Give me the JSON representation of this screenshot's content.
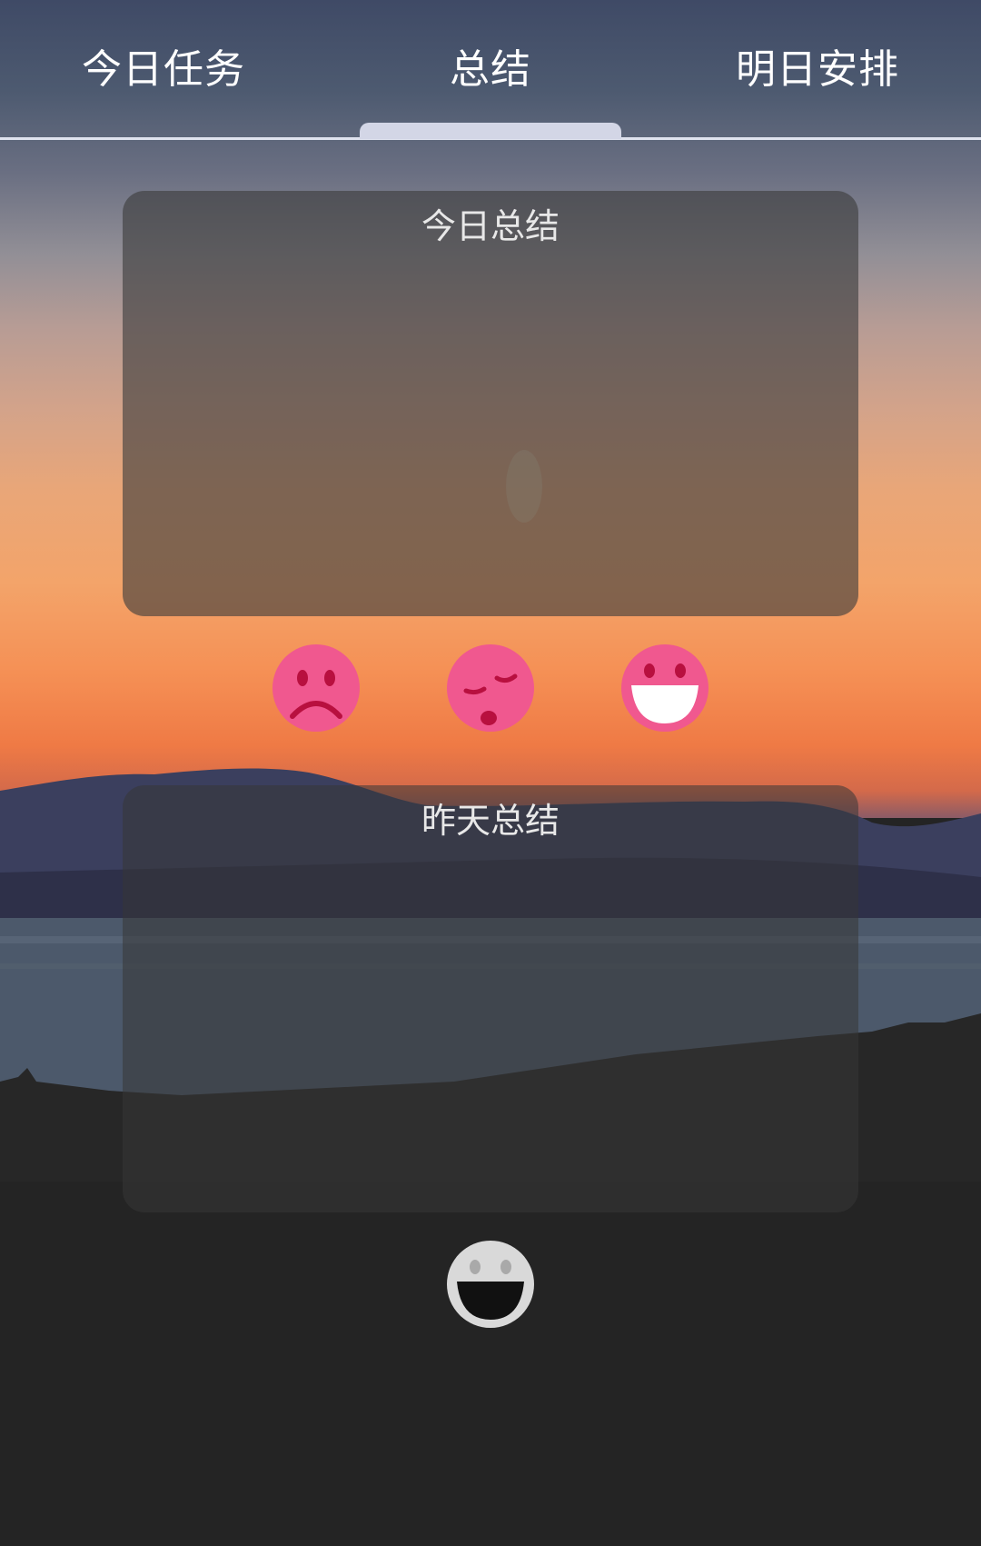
{
  "tabs": [
    {
      "label": "今日任务"
    },
    {
      "label": "总结"
    },
    {
      "label": "明日安排"
    }
  ],
  "active_tab_index": 1,
  "today_card": {
    "title": "今日总结"
  },
  "mood_options": [
    {
      "icon": "sad-face-icon"
    },
    {
      "icon": "tired-face-icon"
    },
    {
      "icon": "happy-face-icon"
    }
  ],
  "yesterday_card": {
    "title": "昨天总结",
    "mood_icon": "happy-face-icon"
  },
  "colors": {
    "mood_face": "#f0588f",
    "mood_feature": "#b8103f",
    "yesterday_face": "#d9d9d9",
    "tab_text": "#ffffff",
    "card_title": "#e8e8e8"
  }
}
